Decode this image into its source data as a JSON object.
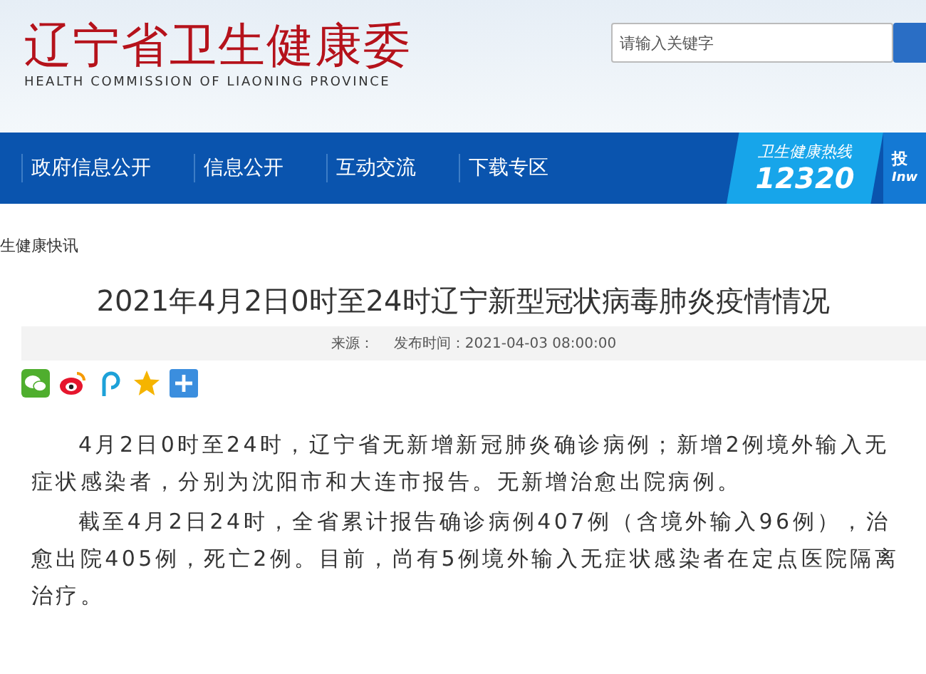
{
  "header": {
    "title": "辽宁省卫生健康委",
    "subtitle": "HEALTH COMMISSION OF LIAONING PROVINCE",
    "search": {
      "placeholder": "请输入关键字"
    }
  },
  "nav": {
    "items": [
      "政府信息公开",
      "信息公开",
      "互动交流",
      "下载专区"
    ],
    "hotline": {
      "label": "卫生健康热线",
      "number": "12320"
    },
    "side": {
      "label": "投",
      "sub": "Inw"
    }
  },
  "breadcrumb": "生健康快讯",
  "article": {
    "title": "2021年4月2日0时至24时辽宁新型冠状病毒肺炎疫情情况",
    "source": "来源：",
    "time": "发布时间：2021-04-03 08:00:00",
    "share": [
      {
        "kind": "wechat"
      },
      {
        "kind": "weibo"
      },
      {
        "kind": "p"
      },
      {
        "kind": "qzone"
      },
      {
        "kind": "plus"
      }
    ],
    "paragraphs": [
      "4月2日0时至24时，辽宁省无新增新冠肺炎确诊病例；新增2例境外输入无症状感染者，分别为沈阳市和大连市报告。无新增治愈出院病例。",
      "截至4月2日24时，全省累计报告确诊病例407例（含境外输入96例），治愈出院405例，死亡2例。目前，尚有5例境外输入无症状感染者在定点医院隔离治疗。"
    ]
  }
}
